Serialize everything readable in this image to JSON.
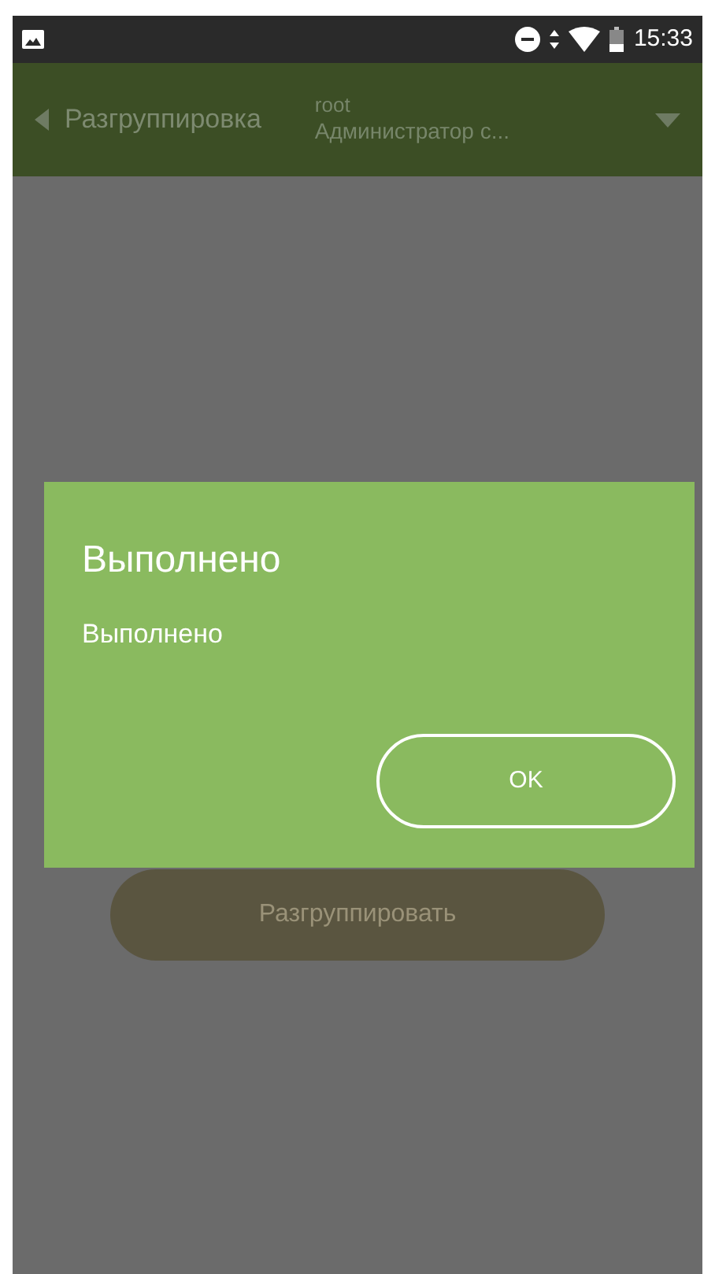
{
  "status_bar": {
    "time": "15:33"
  },
  "app_bar": {
    "title": "Разгруппировка",
    "user": "root",
    "role": "Администратор с..."
  },
  "main_button": {
    "label": "Разгруппировать"
  },
  "dialog": {
    "title": "Выполнено",
    "message": "Выполнено",
    "buttons": [
      "OK"
    ]
  }
}
